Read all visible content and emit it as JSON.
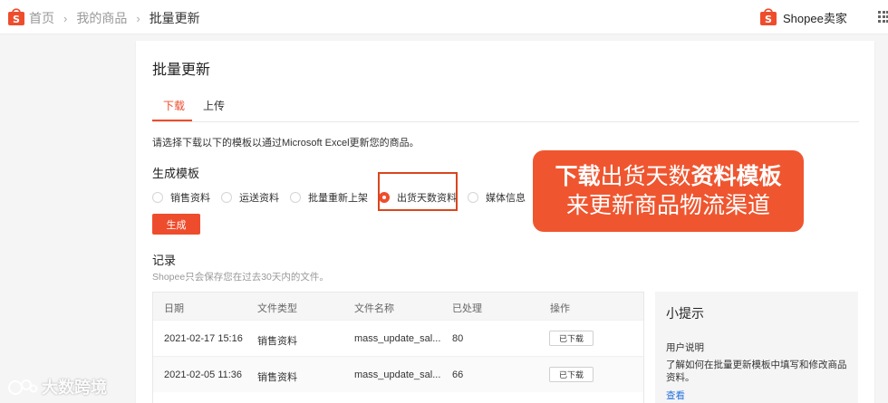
{
  "header": {
    "breadcrumb": [
      "首页",
      "我的商品",
      "批量更新"
    ],
    "brand": "Shopee卖家"
  },
  "page": {
    "title": "批量更新",
    "tabs": [
      {
        "label": "下载",
        "active": true
      },
      {
        "label": "上传",
        "active": false
      }
    ],
    "description": "请选择下载以下的模板以通过Microsoft Excel更新您的商品。",
    "template_section_title": "生成模板",
    "template_options": [
      {
        "label": "销售资料",
        "checked": false
      },
      {
        "label": "运送资料",
        "checked": false
      },
      {
        "label": "批量重新上架",
        "checked": false
      },
      {
        "label": "出货天数资料",
        "checked": true
      },
      {
        "label": "媒体信息",
        "checked": false
      }
    ],
    "generate_button": "生成",
    "records_title": "记录",
    "records_note": "Shopee只会保存您在过去30天内的文件。"
  },
  "records_table": {
    "columns": [
      "日期",
      "文件类型",
      "文件名称",
      "已处理",
      "操作"
    ],
    "rows": [
      {
        "date": "2021-02-17 15:16",
        "type": "销售资料",
        "name": "mass_update_sal...",
        "processed": "80",
        "action": "已下载"
      },
      {
        "date": "2021-02-05 11:36",
        "type": "销售资料",
        "name": "mass_update_sal...",
        "processed": "66",
        "action": "已下载"
      }
    ]
  },
  "tips": {
    "title": "小提示",
    "subtitle": "用户说明",
    "body": "了解如何在批量更新模板中填写和修改商品资料。",
    "link": "查看"
  },
  "callout": {
    "line1_bold_a": "下载",
    "line1_normal": "出货天数",
    "line1_bold_b": "资料模板",
    "line2": "来更新商品物流渠道"
  },
  "watermark": {
    "text": "大数跨境"
  },
  "colors": {
    "accent": "#ee4d2d",
    "callout": "#ef5630",
    "link": "#2673dd",
    "highlight_border": "#d9461e"
  }
}
